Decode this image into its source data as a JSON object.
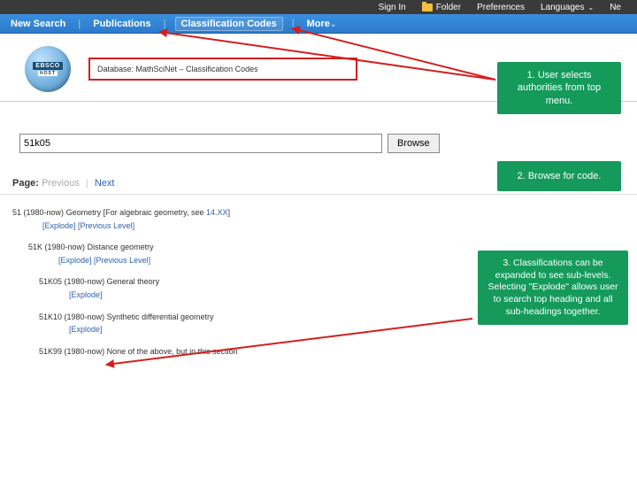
{
  "topbar": {
    "signin": "Sign In",
    "folder": "Folder",
    "prefs": "Preferences",
    "lang": "Languages"
  },
  "navbar": {
    "newsearch": "New Search",
    "pubs": "Publications",
    "classcodes": "Classification Codes",
    "more": "More"
  },
  "logo": {
    "brand": "EBSCO",
    "sub": "HOST"
  },
  "dbline": "Database: MathSciNet – Classification Codes",
  "search": {
    "value": "51k05",
    "browse": "Browse"
  },
  "pager": {
    "label": "Page:",
    "prev": "Previous",
    "next": "Next"
  },
  "callouts": {
    "c1": "1. User selects authorities from top menu.",
    "c2": "2. Browse for code.",
    "c3": "3. Classifications can be expanded to see sub-levels. Selecting \"Explode\" allows user to search top heading and all sub-headings together."
  },
  "tree": {
    "n1": {
      "code": "51",
      "yrs": "(1980-now)",
      "title": "Geometry [For algebraic geometry, see ",
      "see": "14.XX",
      "tail": "]"
    },
    "n2": {
      "code": "51K",
      "yrs": "(1980-now)",
      "title": "Distance geometry"
    },
    "n3": {
      "code": "51K05",
      "yrs": "(1980-now)",
      "title": "General theory"
    },
    "n4": {
      "code": "51K10",
      "yrs": "(1980-now)",
      "title": "Synthetic differential geometry"
    },
    "n5": {
      "code": "51K99",
      "yrs": "(1980-now)",
      "title": "None of the above, but in this section"
    },
    "explode": "[Explode]",
    "prevlevel": "[Previous Level]"
  }
}
